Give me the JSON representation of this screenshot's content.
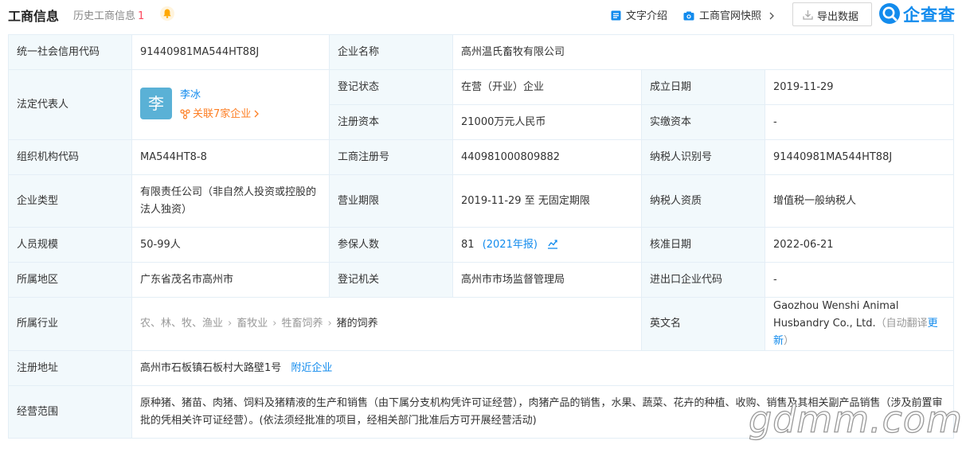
{
  "header": {
    "title": "工商信息",
    "history_label": "历史工商信息",
    "history_count": "1",
    "text_intro": "文字介绍",
    "snapshot": "工商官网快照",
    "export": "导出数据",
    "logo": "企查查"
  },
  "rows": {
    "credit_code": {
      "label": "统一社会信用代码",
      "value": "91440981MA544HT88J"
    },
    "company_name": {
      "label": "企业名称",
      "value": "高州温氏畜牧有限公司"
    },
    "legal_rep": {
      "label": "法定代表人",
      "avatar": "李",
      "name": "李冰",
      "related": "关联7家企业"
    },
    "reg_status": {
      "label": "登记状态",
      "value": "在营（开业）企业"
    },
    "founded": {
      "label": "成立日期",
      "value": "2019-11-29"
    },
    "reg_capital": {
      "label": "注册资本",
      "value": "21000万元人民币"
    },
    "paid_capital": {
      "label": "实缴资本",
      "value": "-"
    },
    "org_code": {
      "label": "组织机构代码",
      "value": "MA544HT8-8"
    },
    "reg_no": {
      "label": "工商注册号",
      "value": "440981000809882"
    },
    "taxpayer_id": {
      "label": "纳税人识别号",
      "value": "91440981MA544HT88J"
    },
    "company_type": {
      "label": "企业类型",
      "value": "有限责任公司（非自然人投资或控股的法人独资）"
    },
    "business_term": {
      "label": "营业期限",
      "value": "2019-11-29 至 无固定期限"
    },
    "taxpayer_qual": {
      "label": "纳税人资质",
      "value": "增值税一般纳税人"
    },
    "staff_size": {
      "label": "人员规模",
      "value": "50-99人"
    },
    "insured": {
      "label": "参保人数",
      "value": "81",
      "year": "(2021年报)"
    },
    "approval_date": {
      "label": "核准日期",
      "value": "2022-06-21"
    },
    "region": {
      "label": "所属地区",
      "value": "广东省茂名市高州市"
    },
    "reg_authority": {
      "label": "登记机关",
      "value": "高州市市场监督管理局"
    },
    "import_export": {
      "label": "进出口企业代码",
      "value": "-"
    },
    "industry": {
      "label": "所属行业",
      "path": [
        "农、林、牧、渔业",
        "畜牧业",
        "牲畜饲养",
        "猪的饲养"
      ]
    },
    "english_name": {
      "label": "英文名",
      "value": "Gaozhou Wenshi Animal Husbandry Co., Ltd.",
      "note": "（自动翻译",
      "update": "更新",
      "note_end": "）"
    },
    "address": {
      "label": "注册地址",
      "value": "高州市石板镇石板村大路壁1号",
      "nearby": "附近企业"
    },
    "scope": {
      "label": "经营范围",
      "value": "原种猪、猪苗、肉猪、饲料及猪精液的生产和销售（由下属分支机构凭许可证经营），肉猪产品的销售，水果、蔬菜、花卉的种植、收购、销售及其相关副产品销售（涉及前置审批的凭相关许可证经营）。(依法须经批准的项目，经相关部门批准后方可开展经营活动)"
    }
  },
  "watermark": "gdmm.com",
  "colors": {
    "accent": "#128bed",
    "label_bg": "#f2f9fc",
    "border": "#e4eef6",
    "orange": "#fd7e23"
  }
}
